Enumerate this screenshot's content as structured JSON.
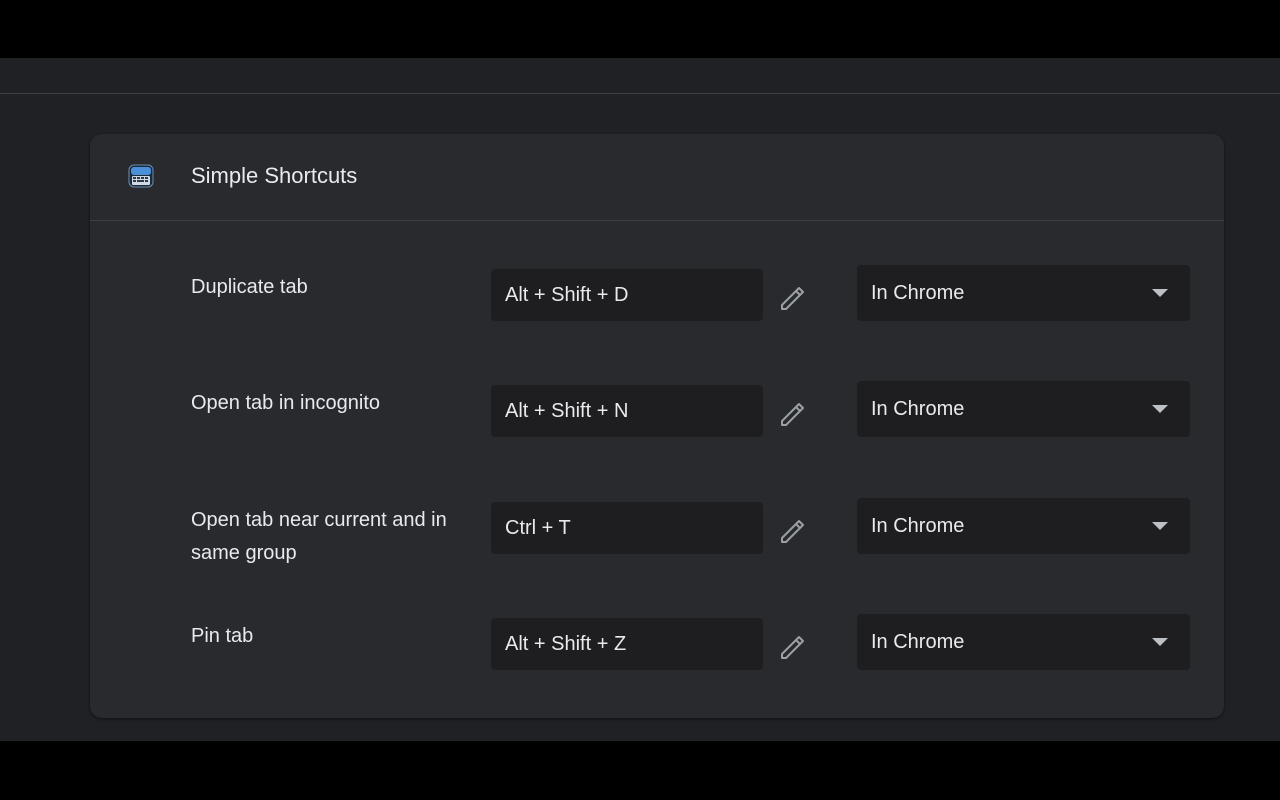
{
  "extension": {
    "title": "Simple Shortcuts",
    "icon": "keyboard-icon"
  },
  "shortcuts": [
    {
      "label": "Duplicate tab",
      "keys": "Alt + Shift + D",
      "scope": "In Chrome"
    },
    {
      "label": "Open tab in incognito",
      "keys": "Alt + Shift + N",
      "scope": "In Chrome"
    },
    {
      "label": "Open tab near current and in same group",
      "keys": "Ctrl + T",
      "scope": "In Chrome"
    },
    {
      "label": "Pin tab",
      "keys": "Alt + Shift + Z",
      "scope": "In Chrome"
    }
  ],
  "colors": {
    "background": "#202124",
    "card": "#292a2d",
    "field": "#1e1e21",
    "text": "#e8eaed",
    "icon": "#9aa0a6"
  }
}
